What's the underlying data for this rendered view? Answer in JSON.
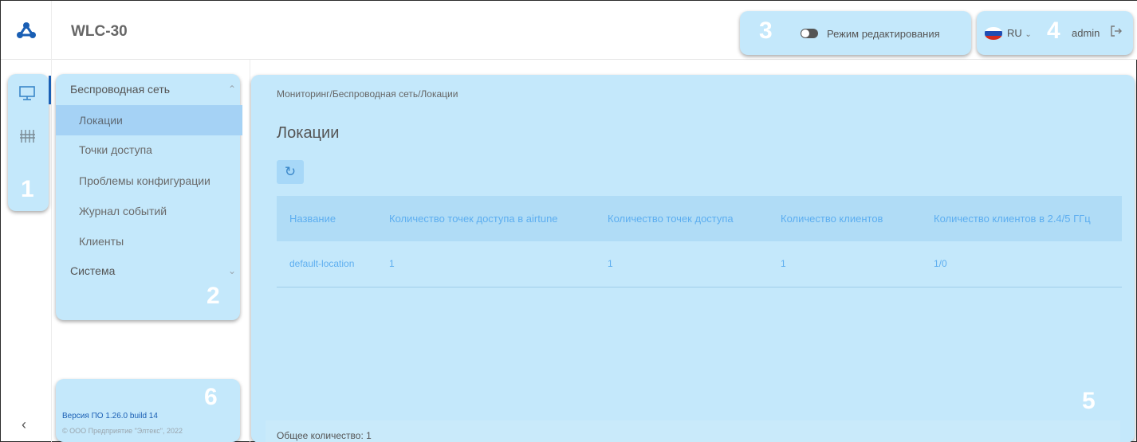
{
  "app": {
    "title": "WLC-30"
  },
  "header": {
    "edit_mode_label": "Режим редактирования",
    "language": "RU",
    "user": "admin"
  },
  "callouts": {
    "n1": "1",
    "n2": "2",
    "n3": "3",
    "n4": "4",
    "n5": "5",
    "n6": "6"
  },
  "sidebar_icons": [
    "monitor-icon",
    "sliders-icon"
  ],
  "nav": {
    "wireless": {
      "label": "Беспроводная сеть",
      "items": [
        {
          "label": "Локации",
          "active": true
        },
        {
          "label": "Точки доступа"
        },
        {
          "label": "Проблемы конфигурации"
        },
        {
          "label": "Журнал событий"
        },
        {
          "label": "Клиенты"
        }
      ]
    },
    "system": {
      "label": "Система"
    }
  },
  "footer": {
    "version": "Версия ПО 1.26.0 build 14",
    "copyright": "© ООО Предприятие \"Элтекс\", 2022"
  },
  "main": {
    "breadcrumb": "Мониторинг/Беспроводная сеть/Локации",
    "title": "Локации",
    "refresh_icon": "refresh-icon",
    "table": {
      "columns": [
        "Название",
        "Количество точек доступа в airtune",
        "Количество точек доступа",
        "Количество клиентов",
        "Количество клиентов в 2.4/5 ГГц"
      ],
      "rows": [
        [
          "default-location",
          "1",
          "1",
          "1",
          "1/0"
        ]
      ]
    },
    "total_label": "Общее количество:",
    "total_value": "1"
  },
  "colors": {
    "callout_bg": "#c4e8fb",
    "active_item": "#a5d2f5",
    "table_header": "#b0dcf6",
    "link_blue": "#5daef0",
    "logo_blue": "#1a5fb4"
  }
}
